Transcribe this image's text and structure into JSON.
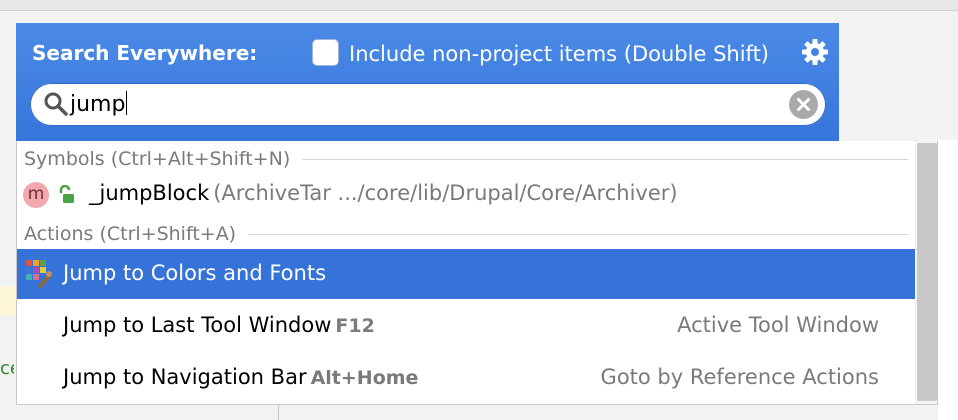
{
  "popup": {
    "title": "Search Everywhere:",
    "include_label": "Include non-project items (Double Shift)",
    "include_checked": false,
    "search_value": "jump"
  },
  "groups": [
    {
      "label": "Symbols (Ctrl+Alt+Shift+N)"
    },
    {
      "label": "Actions (Ctrl+Shift+A)"
    }
  ],
  "symbol": {
    "badge": "m",
    "name": "_jumpBlock",
    "location": "(ArchiveTar .../core/lib/Drupal/Core/Archiver)"
  },
  "actions": [
    {
      "name": "Jump to Colors and Fonts",
      "shortcut": "",
      "category": "",
      "selected": true
    },
    {
      "name": "Jump to Last Tool Window",
      "shortcut": "F12",
      "category": "Active Tool Window",
      "selected": false
    },
    {
      "name": "Jump to Navigation Bar",
      "shortcut": "Alt+Home",
      "category": "Goto by Reference Actions",
      "selected": false
    }
  ],
  "background": {
    "gutter_text": "ce"
  },
  "colors": {
    "header_blue": "#3b7fe0",
    "selection_blue": "#3673d9",
    "muted_text": "#7a7a7a",
    "badge_pink": "#f3a8ad"
  }
}
